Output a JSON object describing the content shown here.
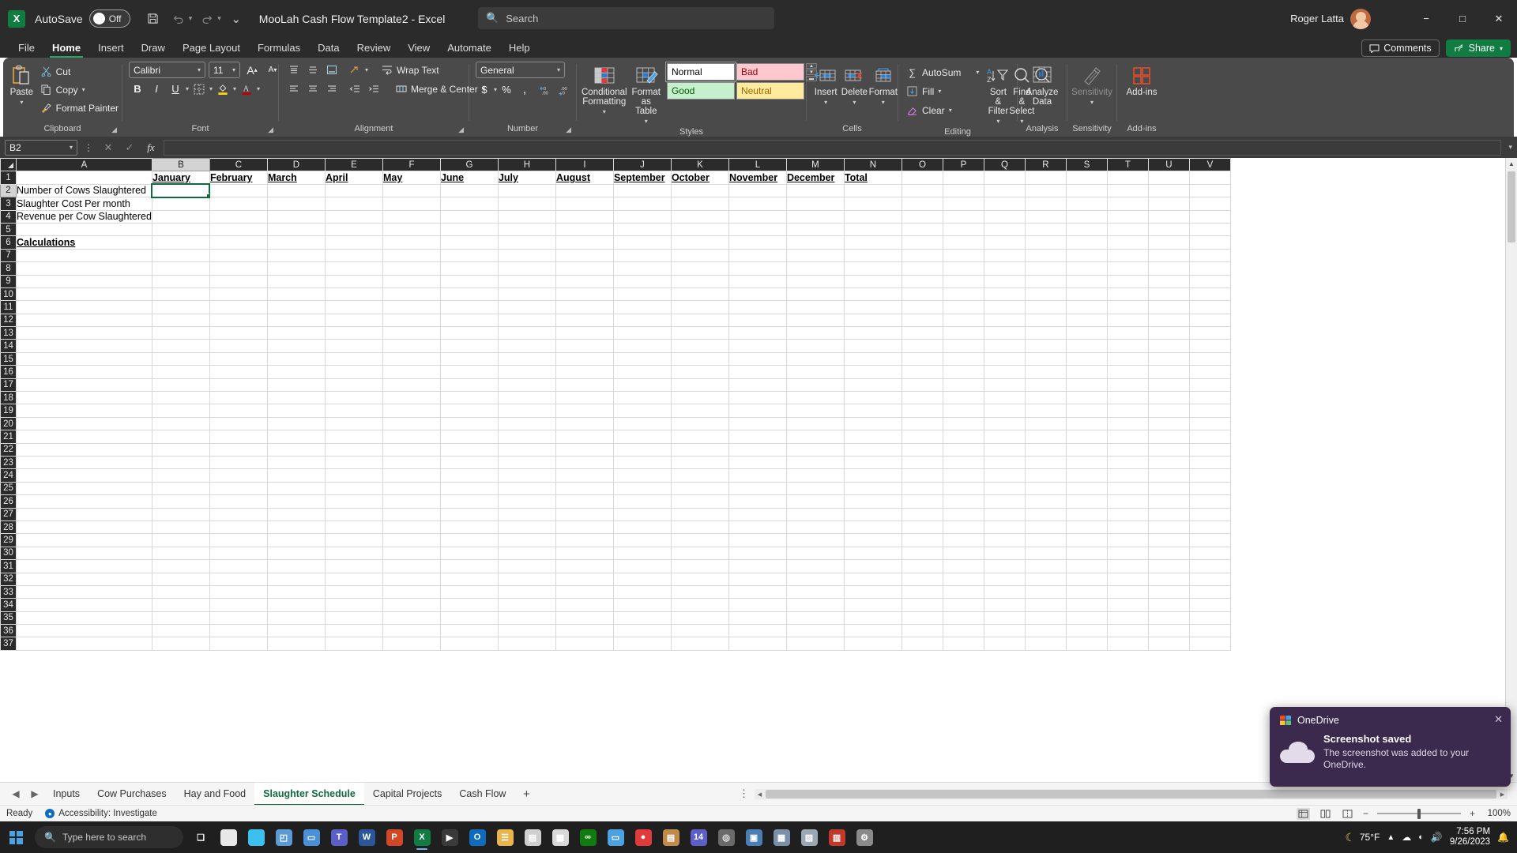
{
  "titlebar": {
    "app_logo": "excel-logo",
    "autosave_label": "AutoSave",
    "autosave_state": "Off",
    "document_title": "MooLah Cash Flow Template2",
    "title_separator": "-",
    "app_name": "Excel",
    "search_placeholder": "Search",
    "user_name": "Roger Latta",
    "minimize": "−",
    "maximize": "□",
    "close": "✕"
  },
  "ribbon_tabs": {
    "items": [
      {
        "label": "File",
        "active": false
      },
      {
        "label": "Home",
        "active": true
      },
      {
        "label": "Insert",
        "active": false
      },
      {
        "label": "Draw",
        "active": false
      },
      {
        "label": "Page Layout",
        "active": false
      },
      {
        "label": "Formulas",
        "active": false
      },
      {
        "label": "Data",
        "active": false
      },
      {
        "label": "Review",
        "active": false
      },
      {
        "label": "View",
        "active": false
      },
      {
        "label": "Automate",
        "active": false
      },
      {
        "label": "Help",
        "active": false
      }
    ],
    "comments_label": "Comments",
    "share_label": "Share"
  },
  "ribbon": {
    "clipboard": {
      "group_label": "Clipboard",
      "paste_label": "Paste",
      "cut_label": "Cut",
      "copy_label": "Copy",
      "format_painter_label": "Format Painter"
    },
    "font": {
      "group_label": "Font",
      "font_name": "Calibri",
      "font_size": "11",
      "grow_font": "A",
      "shrink_font": "A",
      "bold": "B",
      "italic": "I",
      "underline": "U"
    },
    "alignment": {
      "group_label": "Alignment",
      "wrap_text_label": "Wrap Text",
      "merge_center_label": "Merge & Center"
    },
    "number": {
      "group_label": "Number",
      "format": "General",
      "currency": "$",
      "percent": "%",
      "comma": ",",
      "increase_decimal": ".00",
      "decrease_decimal": ".00"
    },
    "styles": {
      "group_label": "Styles",
      "conditional_formatting_label": "Conditional Formatting",
      "format_as_table_label": "Format as Table",
      "gallery": [
        {
          "name": "Normal",
          "bg": "#ffffff",
          "fg": "#000000"
        },
        {
          "name": "Bad",
          "bg": "#ffc7ce",
          "fg": "#9c0006"
        },
        {
          "name": "Good",
          "bg": "#c6efce",
          "fg": "#006100"
        },
        {
          "name": "Neutral",
          "bg": "#ffeb9c",
          "fg": "#9c6500"
        }
      ]
    },
    "cells": {
      "group_label": "Cells",
      "insert_label": "Insert",
      "delete_label": "Delete",
      "format_label": "Format"
    },
    "editing": {
      "group_label": "Editing",
      "autosum_label": "AutoSum",
      "fill_label": "Fill",
      "clear_label": "Clear",
      "sort_filter_label": "Sort & Filter",
      "find_select_label": "Find & Select"
    },
    "analysis": {
      "group_label": "Analysis",
      "analyze_data_label": "Analyze Data"
    },
    "sensitivity": {
      "group_label": "Sensitivity",
      "sensitivity_label": "Sensitivity"
    },
    "addins": {
      "group_label": "Add-ins",
      "addins_label": "Add-ins"
    }
  },
  "formula_bar": {
    "name_box": "B2",
    "cancel_icon": "✕",
    "enter_icon": "✓",
    "function_icon": "fx",
    "formula_value": ""
  },
  "grid": {
    "selected_cell": "B2",
    "selected_column": "B",
    "selected_row": 2,
    "columns": [
      "A",
      "B",
      "C",
      "D",
      "E",
      "F",
      "G",
      "H",
      "I",
      "J",
      "K",
      "L",
      "M",
      "N",
      "O",
      "P",
      "Q",
      "R",
      "S",
      "T",
      "U",
      "V"
    ],
    "row_count": 37,
    "cells": {
      "B1": "January",
      "C1": "February",
      "D1": "March",
      "E1": "April",
      "F1": "May",
      "G1": "June",
      "H1": "July",
      "I1": "August",
      "J1": "September",
      "K1": "October",
      "L1": "November",
      "M1": "December",
      "N1": "Total",
      "A2": "Number of Cows Slaughtered",
      "A3": "Slaughter Cost Per month",
      "A4": "Revenue per Cow Slaughtered",
      "A6": "Calculations"
    }
  },
  "sheet_tabs": {
    "prev_icon": "◀",
    "next_icon": "▶",
    "items": [
      {
        "label": "Inputs",
        "active": false
      },
      {
        "label": "Cow Purchases",
        "active": false
      },
      {
        "label": "Hay and Food",
        "active": false
      },
      {
        "label": "Slaughter Schedule",
        "active": true
      },
      {
        "label": "Capital Projects",
        "active": false
      },
      {
        "label": "Cash Flow",
        "active": false
      }
    ],
    "add_sheet": "+"
  },
  "status_bar": {
    "status": "Ready",
    "accessibility": "Accessibility: Investigate",
    "zoom": "100%",
    "views": [
      "normal-view",
      "page-layout-view",
      "page-break-view"
    ]
  },
  "toast": {
    "app": "OneDrive",
    "title": "Screenshot saved",
    "message": "The screenshot was added to your OneDrive.",
    "close": "✕"
  },
  "taskbar": {
    "search_placeholder": "Type here to search",
    "apps": [
      {
        "name": "task-view",
        "glyph": "❑",
        "color": "transparent"
      },
      {
        "name": "chrome",
        "glyph": "",
        "color": "#e8e8e8"
      },
      {
        "name": "edge",
        "glyph": "",
        "color": "#3bc0f0"
      },
      {
        "name": "photos",
        "glyph": "◰",
        "color": "#5a9bd5"
      },
      {
        "name": "folder-blue",
        "glyph": "▭",
        "color": "#4a90d9"
      },
      {
        "name": "teams",
        "glyph": "T",
        "color": "#5b5fc7"
      },
      {
        "name": "word",
        "glyph": "W",
        "color": "#2b579a"
      },
      {
        "name": "powerpoint",
        "glyph": "P",
        "color": "#d24726"
      },
      {
        "name": "excel",
        "glyph": "X",
        "color": "#107c41",
        "active": true
      },
      {
        "name": "app-dark",
        "glyph": "▶",
        "color": "#3a3a3a"
      },
      {
        "name": "outlook",
        "glyph": "O",
        "color": "#0f6cbd"
      },
      {
        "name": "file-explorer",
        "glyph": "☰",
        "color": "#e9b44c"
      },
      {
        "name": "store",
        "glyph": "▤",
        "color": "#cfcfcf"
      },
      {
        "name": "calendar",
        "glyph": "▦",
        "color": "#d9d9d9"
      },
      {
        "name": "xbox",
        "glyph": "∞",
        "color": "#107c10"
      },
      {
        "name": "notepad",
        "glyph": "▭",
        "color": "#4aa3e0"
      },
      {
        "name": "media-player",
        "glyph": "●",
        "color": "#e03b3b"
      },
      {
        "name": "books",
        "glyph": "▤",
        "color": "#c08a4a"
      },
      {
        "name": "teams-2",
        "glyph": "14",
        "color": "#5b5fc7"
      },
      {
        "name": "camera",
        "glyph": "◎",
        "color": "#6a6a6a"
      },
      {
        "name": "calculator",
        "glyph": "▣",
        "color": "#4a7fb5"
      },
      {
        "name": "grid-app",
        "glyph": "▦",
        "color": "#7a8fa8"
      },
      {
        "name": "chart-app",
        "glyph": "▨",
        "color": "#9aa7b5"
      },
      {
        "name": "recorder",
        "glyph": "▥",
        "color": "#c0392b"
      },
      {
        "name": "settings",
        "glyph": "⚙",
        "color": "#8a8a8a"
      }
    ],
    "weather_temp": "75°F",
    "weather_icon": "moon-icon",
    "time": "7:56 PM",
    "date": "9/26/2023",
    "tray_icons": [
      "chevron-up-icon",
      "onedrive-icon",
      "network-icon",
      "volume-icon"
    ]
  }
}
